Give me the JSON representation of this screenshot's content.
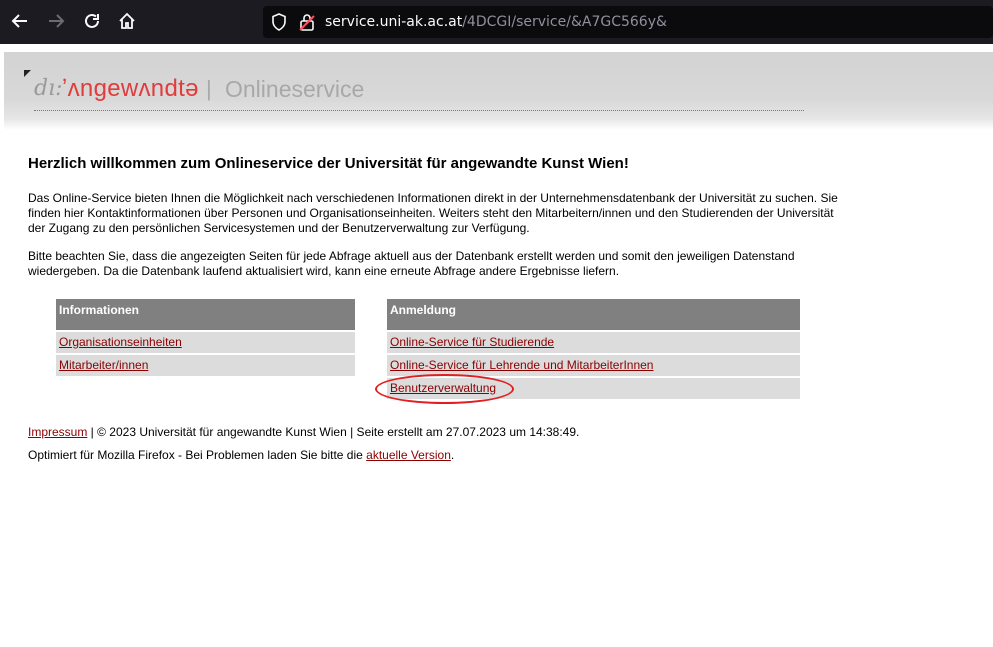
{
  "browser": {
    "url_host": "service.uni-ak.ac.at",
    "url_path": "/4DCGI/service/&A7GC566y&"
  },
  "header": {
    "logo_prefix": "dı:",
    "logo_name": "ʼʌngewʌndtə",
    "separator": "|",
    "service_title": "Onlineservice"
  },
  "main": {
    "heading": "Herzlich willkommen zum Onlineservice der Universität für angewandte Kunst Wien!",
    "paragraph1": "Das Online-Service bieten Ihnen die Möglichkeit nach verschiedenen Informationen direkt in der Unternehmensdatenbank der Universität zu suchen. Sie finden hier Kontaktinformationen über Personen und Organisationseinheiten. Weiters steht den Mitarbeitern/innen und den Studierenden der Universität der Zugang zu den persönlichen Servicesystemen und der Benutzerverwaltung zur Verfügung.",
    "paragraph2": "Bitte beachten Sie, dass die angezeigten Seiten für jede Abfrage aktuell aus der Datenbank erstellt werden und somit den jeweiligen Datenstand wiedergeben. Da die Datenbank laufend aktualisiert wird, kann eine erneute Abfrage andere Ergebnisse liefern."
  },
  "info_box": {
    "title": "Informationen",
    "links": [
      "Organisationseinheiten",
      "Mitarbeiter/innen"
    ]
  },
  "login_box": {
    "title": "Anmeldung",
    "links": [
      "Online-Service für Studierende",
      "Online-Service für Lehrende und MitarbeiterInnen",
      "Benutzerverwaltung"
    ]
  },
  "footer": {
    "impressum": "Impressum",
    "copyright": " | © 2023 Universität für angewandte Kunst Wien | Seite erstellt am 27.07.2023 um 14:38:49.",
    "optimized": "Optimiert für Mozilla Firefox - Bei Problemen laden Sie bitte die ",
    "version_link": "aktuelle Version",
    "period": "."
  }
}
